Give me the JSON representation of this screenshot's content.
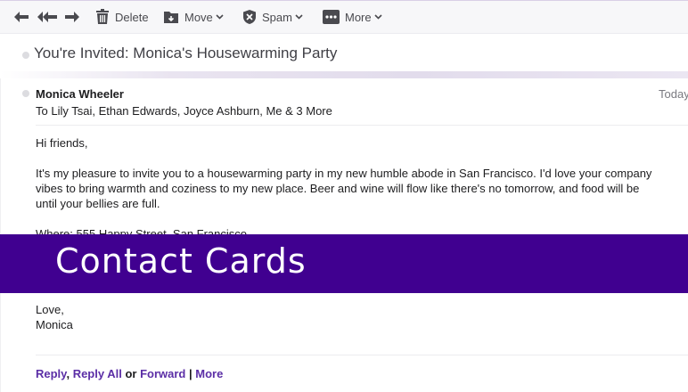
{
  "toolbar": {
    "delete_label": "Delete",
    "move_label": "Move",
    "spam_label": "Spam",
    "more_label": "More"
  },
  "email": {
    "subject": "You're Invited: Monica's Housewarming Party",
    "sender": "Monica Wheeler",
    "recipients": "To Lily Tsai, Ethan Edwards, Joyce Ashburn, Me & 3 More",
    "date": "Today",
    "greeting": "Hi friends,",
    "paragraph_lines": [
      "It's my pleasure to invite you to a housewarming party in my new humble abode in San Francisco. I'd love your company",
      "vibes to bring warmth and coziness to my new place. Beer and wine will flow like there's no tomorrow, and food will be",
      "until your bellies are full."
    ],
    "where_line": "Where: 555 Happy Street, San Francisco",
    "signoff": "Love,",
    "signature": "Monica"
  },
  "footer": {
    "reply": "Reply",
    "comma": ",",
    "reply_all": "Reply All",
    "or": "or",
    "forward": "Forward",
    "pipe": "|",
    "more": "More"
  },
  "banner": {
    "text": "Contact Cards"
  },
  "colors": {
    "accent": "#5b2ea6",
    "banner": "#400090"
  }
}
